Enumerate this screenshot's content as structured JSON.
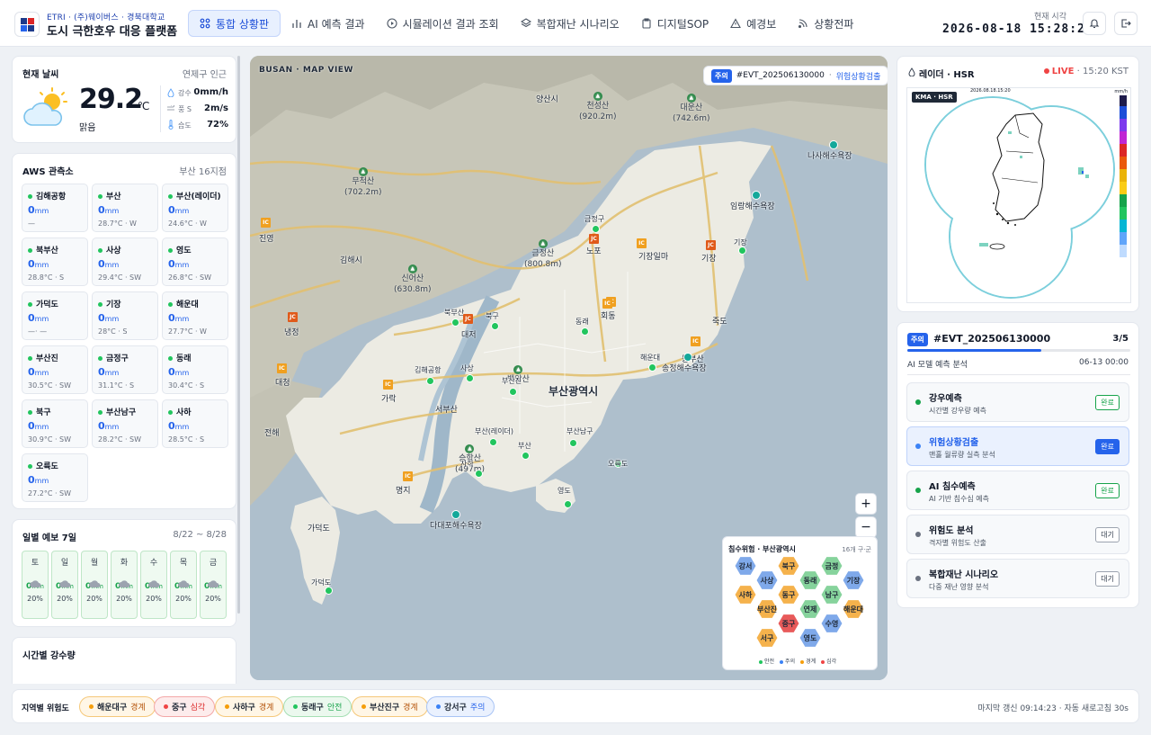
{
  "header": {
    "subtitle": "ETRI · (주)웨이버스 · 경북대학교",
    "title": "도시 극한호우 대응 플랫폼",
    "nav": [
      {
        "label": "통합 상황판",
        "icon": "grid-icon",
        "active": true
      },
      {
        "label": "AI 예측 결과",
        "icon": "bar-chart-icon"
      },
      {
        "label": "시뮬레이션 결과 조회",
        "icon": "play-icon"
      },
      {
        "label": "복합재난 시나리오",
        "icon": "layers-icon"
      },
      {
        "label": "디지털SOP",
        "icon": "clipboard-icon"
      },
      {
        "label": "예경보",
        "icon": "alert-icon"
      },
      {
        "label": "상황전파",
        "icon": "broadcast-icon"
      }
    ],
    "clock_label": "현재 시각",
    "clock": "2026-08-18 15:28:26"
  },
  "weather": {
    "title": "현재 날씨",
    "location": "연제구 인근",
    "temp": "29.2",
    "unit": "℃",
    "condition": "맑음",
    "stats": [
      {
        "label": "강수",
        "value": "0mm/h",
        "icon": "droplet-icon"
      },
      {
        "label": "풍 S",
        "value": "2m/s",
        "icon": "wind-icon"
      },
      {
        "label": "습도",
        "value": "72%",
        "icon": "thermometer-icon"
      }
    ]
  },
  "aws": {
    "title": "AWS 관측소",
    "count": "부산 16지점",
    "stations": [
      {
        "name": "김해공항",
        "value": "0",
        "meta": "—"
      },
      {
        "name": "부산",
        "value": "0",
        "meta": "28.7°C · W"
      },
      {
        "name": "부산(레이더)",
        "value": "0",
        "meta": "24.6°C · W"
      },
      {
        "name": "북부산",
        "value": "0",
        "meta": "28.8°C · S"
      },
      {
        "name": "사상",
        "value": "0",
        "meta": "29.4°C · SW"
      },
      {
        "name": "영도",
        "value": "0",
        "meta": "26.8°C · SW"
      },
      {
        "name": "가덕도",
        "value": "0",
        "meta": "—· —"
      },
      {
        "name": "기장",
        "value": "0",
        "meta": "28°C · S"
      },
      {
        "name": "해운대",
        "value": "0",
        "meta": "27.7°C · W"
      },
      {
        "name": "부산진",
        "value": "0",
        "meta": "30.5°C · SW"
      },
      {
        "name": "금정구",
        "value": "0",
        "meta": "31.1°C · S"
      },
      {
        "name": "동래",
        "value": "0",
        "meta": "30.4°C · S"
      },
      {
        "name": "북구",
        "value": "0",
        "meta": "30.9°C · SW"
      },
      {
        "name": "부산남구",
        "value": "0",
        "meta": "28.2°C · SW"
      },
      {
        "name": "사하",
        "value": "0",
        "meta": "28.5°C · S"
      },
      {
        "name": "오륙도",
        "value": "0",
        "meta": "27.2°C · SW"
      }
    ],
    "unit": "mm"
  },
  "forecast": {
    "title": "일별 예보 7일",
    "range": "8/22 ~ 8/28",
    "days": [
      {
        "day": "토",
        "value": "0",
        "pct": "20%"
      },
      {
        "day": "일",
        "value": "0",
        "pct": "20%"
      },
      {
        "day": "월",
        "value": "0",
        "pct": "20%"
      },
      {
        "day": "화",
        "value": "0",
        "pct": "20%"
      },
      {
        "day": "수",
        "value": "0",
        "pct": "20%"
      },
      {
        "day": "목",
        "value": "0",
        "pct": "20%"
      },
      {
        "day": "금",
        "value": "0",
        "pct": "20%"
      }
    ],
    "unit": "mm"
  },
  "hourly_rain": {
    "title": "시간별 강수량"
  },
  "map": {
    "title": "BUSAN · MAP VIEW",
    "event_badge": "주의",
    "event_id": "#EVT_202506130000",
    "event_stage": "위험상황검출",
    "city_label": "부산광역시",
    "place_labels": [
      "양산시",
      "김해시",
      "진영",
      "냉정",
      "대저",
      "대청",
      "가락",
      "서부산",
      "명지",
      "가덕도",
      "노포",
      "기장일마",
      "기장",
      "죽도",
      "동부산",
      "회동",
      "전해"
    ],
    "peaks": [
      {
        "name": "천성산",
        "h": "(920.2m)"
      },
      {
        "name": "대운산",
        "h": "(742.6m)"
      },
      {
        "name": "무척산",
        "h": "(702.2m)"
      },
      {
        "name": "신어산",
        "h": "(630.8m)"
      },
      {
        "name": "금정산",
        "h": "(800.8m)"
      },
      {
        "name": "승학산",
        "h": "(497m)"
      },
      {
        "name": "백양산",
        "h": ""
      }
    ],
    "ports": [
      "나사해수욕장",
      "임랑해수욕장",
      "송정해수욕장",
      "다대포해수욕장"
    ],
    "stations": [
      "금정구",
      "북부산",
      "북구",
      "동래",
      "김해공항",
      "사상",
      "부산진",
      "해운대",
      "부산(레이더)",
      "부산남구",
      "사하",
      "부산",
      "오륙도",
      "영도",
      "기장",
      "가덕도"
    ],
    "jc_label": "JC",
    "ic_label": "IC",
    "zoom_in": "+",
    "zoom_out": "−",
    "hex": {
      "title": "침수위험 · 부산광역시",
      "count": "16개 구·군",
      "cells": [
        {
          "name": "강서",
          "level": "caution"
        },
        {
          "name": "북구",
          "level": "warning"
        },
        {
          "name": "금정",
          "level": "safe"
        },
        {
          "name": "사상",
          "level": "caution"
        },
        {
          "name": "동래",
          "level": "safe"
        },
        {
          "name": "기장",
          "level": "caution"
        },
        {
          "name": "사하",
          "level": "warning"
        },
        {
          "name": "동구",
          "level": "warning"
        },
        {
          "name": "남구",
          "level": "safe"
        },
        {
          "name": "부산진",
          "level": "warning"
        },
        {
          "name": "연제",
          "level": "safe"
        },
        {
          "name": "해운대",
          "level": "warning"
        },
        {
          "name": "중구",
          "level": "severe"
        },
        {
          "name": "수영",
          "level": "caution"
        },
        {
          "name": "서구",
          "level": "warning"
        },
        {
          "name": "영도",
          "level": "caution"
        }
      ],
      "legend": [
        {
          "label": "안전",
          "color": "#22c55e"
        },
        {
          "label": "주의",
          "color": "#3b82f6"
        },
        {
          "label": "경계",
          "color": "#f59e0b"
        },
        {
          "label": "심각",
          "color": "#ef4444"
        }
      ]
    }
  },
  "radar": {
    "title": "레이더 · HSR",
    "live": "LIVE",
    "time": "15:20 KST",
    "img_label": "KMA · HSR",
    "img_stamp": "2026.08.18.15:20",
    "unit": "mm/h"
  },
  "event": {
    "badge": "주의",
    "id": "#EVT_202506130000",
    "progress": "3/5",
    "progress_fraction": 0.6,
    "analysis_label": "AI 모델 예측 분석",
    "analysis_time": "06-13 00:00",
    "steps": [
      {
        "title": "강우예측",
        "desc": "시간별 강우량 예측",
        "status": "완료",
        "state": "done"
      },
      {
        "title": "위험상황검출",
        "desc": "맨홀 월류량 실측 분석",
        "status": "완료",
        "state": "active"
      },
      {
        "title": "AI 침수예측",
        "desc": "AI 기반 침수심 예측",
        "status": "완료",
        "state": "done"
      },
      {
        "title": "위험도 분석",
        "desc": "격자별 위험도 산출",
        "status": "대기",
        "state": "wait"
      },
      {
        "title": "복합재난 시나리오",
        "desc": "다중 재난 영향 분석",
        "status": "대기",
        "state": "wait"
      }
    ]
  },
  "footer": {
    "label": "지역별 위험도",
    "regions": [
      {
        "name": "해운대구",
        "level": "경계",
        "kind": "warning"
      },
      {
        "name": "중구",
        "level": "심각",
        "kind": "severe"
      },
      {
        "name": "사하구",
        "level": "경계",
        "kind": "warning"
      },
      {
        "name": "동래구",
        "level": "안전",
        "kind": "safe"
      },
      {
        "name": "부산진구",
        "level": "경계",
        "kind": "warning"
      },
      {
        "name": "강서구",
        "level": "주의",
        "kind": "caution"
      }
    ],
    "status": "마지막 갱신 09:14:23 · 자동 새로고침 30s"
  },
  "colors": {
    "accent": "#2563eb",
    "safe": "#22c55e",
    "caution": "#3b82f6",
    "warning": "#f59e0b",
    "severe": "#ef4444"
  }
}
